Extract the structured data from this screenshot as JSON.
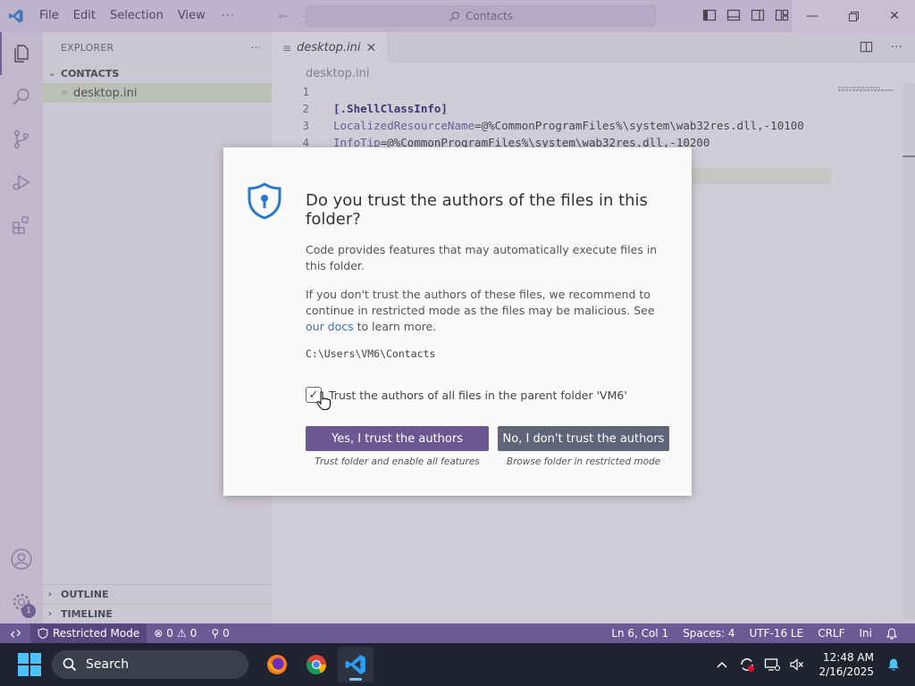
{
  "titlebar": {
    "menu": [
      "File",
      "Edit",
      "Selection",
      "View"
    ],
    "more": "···",
    "search_text": "Contacts"
  },
  "sidebar": {
    "header": "EXPLORER",
    "more": "···",
    "section": "CONTACTS",
    "files": [
      "desktop.ini"
    ],
    "outline": "OUTLINE",
    "timeline": "TIMELINE"
  },
  "activity": {
    "badge": "1"
  },
  "editor": {
    "tab": "desktop.ini",
    "breadcrumb": "desktop.ini",
    "lines": [
      {
        "n": "1",
        "text": ""
      },
      {
        "n": "2",
        "text": "[.ShellClassInfo]"
      },
      {
        "n": "3",
        "key": "LocalizedResourceName",
        "val": "=@%CommonProgramFiles%\\system\\wab32res.dll,-10100"
      },
      {
        "n": "4",
        "key": "InfoTip",
        "val": "=@%CommonProgramFiles%\\system\\wab32res.dll,-10200"
      }
    ]
  },
  "dialog": {
    "title": "Do you trust the authors of the files in this folder?",
    "p1": "Code provides features that may automatically execute files in this folder.",
    "p2_before": "If you don't trust the authors of these files, we recommend to continue in restricted mode as the files may be malicious. See ",
    "p2_link": "our docs",
    "p2_after": " to learn more.",
    "path": "C:\\Users\\VM6\\Contacts",
    "checkbox_label": "Trust the authors of all files in the parent folder 'VM6'",
    "checkbox_checked": true,
    "yes_button": "Yes, I trust the authors",
    "yes_sub": "Trust folder and enable all features",
    "no_button": "No, I don't trust the authors",
    "no_sub": "Browse folder in restricted mode"
  },
  "statusbar": {
    "restricted": "Restricted Mode",
    "errors": "0",
    "warnings": "0",
    "ports": "0",
    "position": "Ln 6, Col 1",
    "spaces": "Spaces: 4",
    "encoding": "UTF-16 LE",
    "eol": "CRLF",
    "language": "Ini"
  },
  "taskbar": {
    "search": "Search",
    "time": "12:48 AM",
    "date": "2/16/2025"
  },
  "colors": {
    "accent": "#6a5a95",
    "primary_button": "#6c5891",
    "secondary_button": "#5f6476",
    "taskbar": "#1f2430"
  }
}
